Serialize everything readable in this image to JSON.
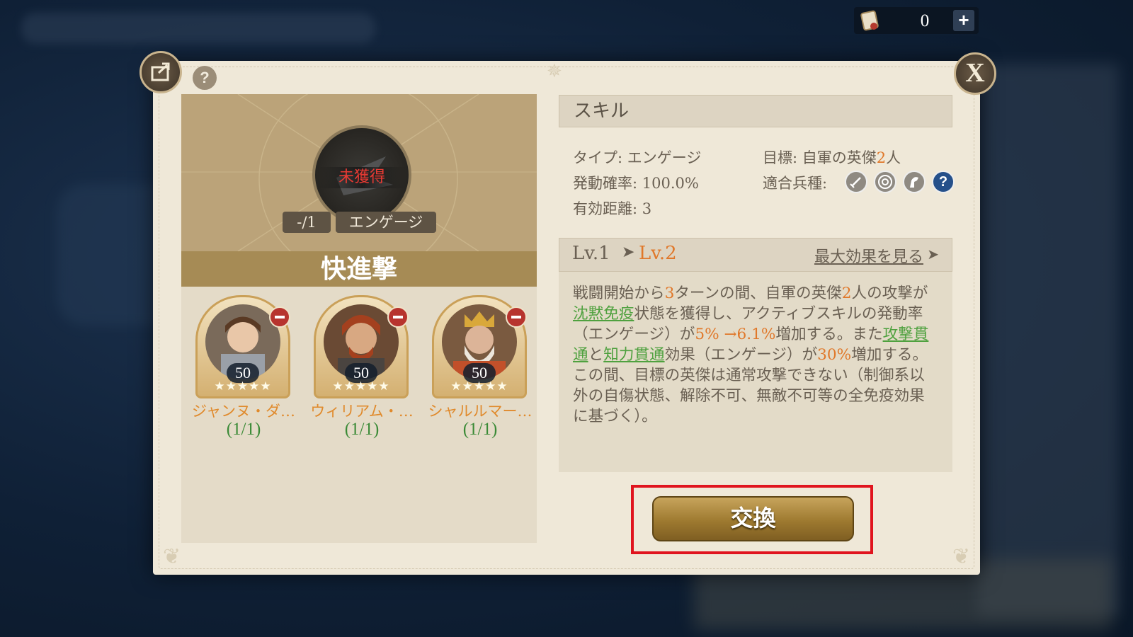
{
  "currency": {
    "value": "0",
    "plus": "+"
  },
  "dialog": {
    "help": "?",
    "close": "X",
    "skill": {
      "status": "未獲得",
      "count_tag": "-/1",
      "type_tag": "エンゲージ",
      "name": "快進撃"
    },
    "heroes": [
      {
        "level": "50",
        "stars": "★★★★★",
        "name": "ジャンヌ・ダ…",
        "count": "(1/1)"
      },
      {
        "level": "50",
        "stars": "★★★★★",
        "name": "ウィリアム・…",
        "count": "(1/1)"
      },
      {
        "level": "50",
        "stars": "★★★★★",
        "name": "シャルルマー…",
        "count": "(1/1)"
      }
    ],
    "detail": {
      "header": "スキル",
      "type_label": "タイプ: ",
      "type_value": "エンゲージ",
      "target_label": "目標: ",
      "target_value_pre": "自軍の英傑",
      "target_value_num": "2",
      "target_value_post": "人",
      "rate_label": "発動確率: ",
      "rate_value": "100.0%",
      "units_label": "適合兵種: ",
      "range_label": "有効距離: ",
      "range_value": "3",
      "unit_icons": [
        "sword-icon",
        "target-icon",
        "horse-icon",
        "help-icon"
      ],
      "unit_help": "?",
      "lv_from": "Lv.1",
      "lv_arrow": "➤",
      "lv_to": "Lv.2",
      "max_effect": "最大効果を見る",
      "max_arrow": "➤",
      "desc": {
        "p1": "戦闘開始から",
        "n1": "3",
        "p2": "ターンの間、自軍の英傑",
        "n2": "2",
        "p3": "人の攻撃が",
        "k1": "沈黙免疫",
        "p4": "状態を獲得し、アクティブスキルの発動率（エンゲージ）が",
        "n3": "5% →6.1%",
        "p5": "増加する。また",
        "k2": "攻撃貫通",
        "p6": "と",
        "k3": "知力貫通",
        "p7": "効果（エンゲージ）が",
        "n4": "30%",
        "p8": "増加する。この間、目標の英傑は通常攻撃できない（制御系以外の自傷状態、解除不可、無敵不可等の全免疫効果に基づく）。"
      }
    },
    "exchange_button": "交換"
  }
}
